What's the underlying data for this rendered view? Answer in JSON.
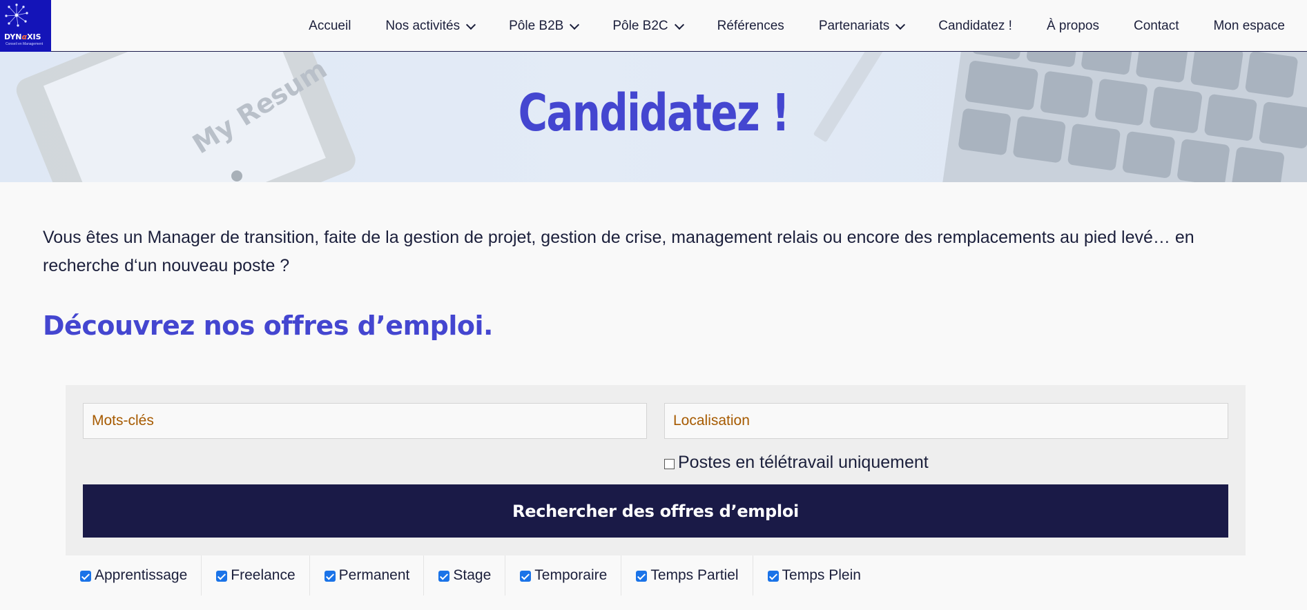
{
  "logo": {
    "word_pre": "DYN",
    "word_alpha": "α",
    "word_post": "XIS",
    "tagline": "Conseil en Management"
  },
  "nav": {
    "items": [
      {
        "label": "Accueil",
        "has_dropdown": false
      },
      {
        "label": "Nos activités",
        "has_dropdown": true
      },
      {
        "label": "Pôle B2B",
        "has_dropdown": true
      },
      {
        "label": "Pôle B2C",
        "has_dropdown": true
      },
      {
        "label": "Références",
        "has_dropdown": false
      },
      {
        "label": "Partenariats",
        "has_dropdown": true
      },
      {
        "label": "Candidatez !",
        "has_dropdown": false
      },
      {
        "label": "À propos",
        "has_dropdown": false
      },
      {
        "label": "Contact",
        "has_dropdown": false
      },
      {
        "label": "Mon espace",
        "has_dropdown": false
      }
    ]
  },
  "hero": {
    "title": "Candidatez !",
    "decor_text": "My Resum"
  },
  "main": {
    "intro": "Vous êtes un Manager de transition, faite de la gestion de projet, gestion de crise, management relais ou encore des remplacements au pied levé… en recherche d‘un nouveau poste ?",
    "offers_title": "Découvrez nos offres d’emploi."
  },
  "search": {
    "keywords_placeholder": "Mots-clés",
    "location_placeholder": "Localisation",
    "remote_label": "Postes en télétravail uniquement",
    "remote_checked": false,
    "submit_label": "Rechercher des offres d’emploi"
  },
  "job_types": [
    {
      "label": "Apprentissage",
      "checked": true
    },
    {
      "label": "Freelance",
      "checked": true
    },
    {
      "label": "Permanent",
      "checked": true
    },
    {
      "label": "Stage",
      "checked": true
    },
    {
      "label": "Temporaire",
      "checked": true
    },
    {
      "label": "Temps Partiel",
      "checked": true
    },
    {
      "label": "Temps Plein",
      "checked": true
    }
  ],
  "colors": {
    "brand_blue": "#4446d0",
    "logo_bg": "#1414b8",
    "button_bg": "#1a1a47",
    "placeholder": "#a65a00",
    "checkbox": "#1a73e8"
  }
}
